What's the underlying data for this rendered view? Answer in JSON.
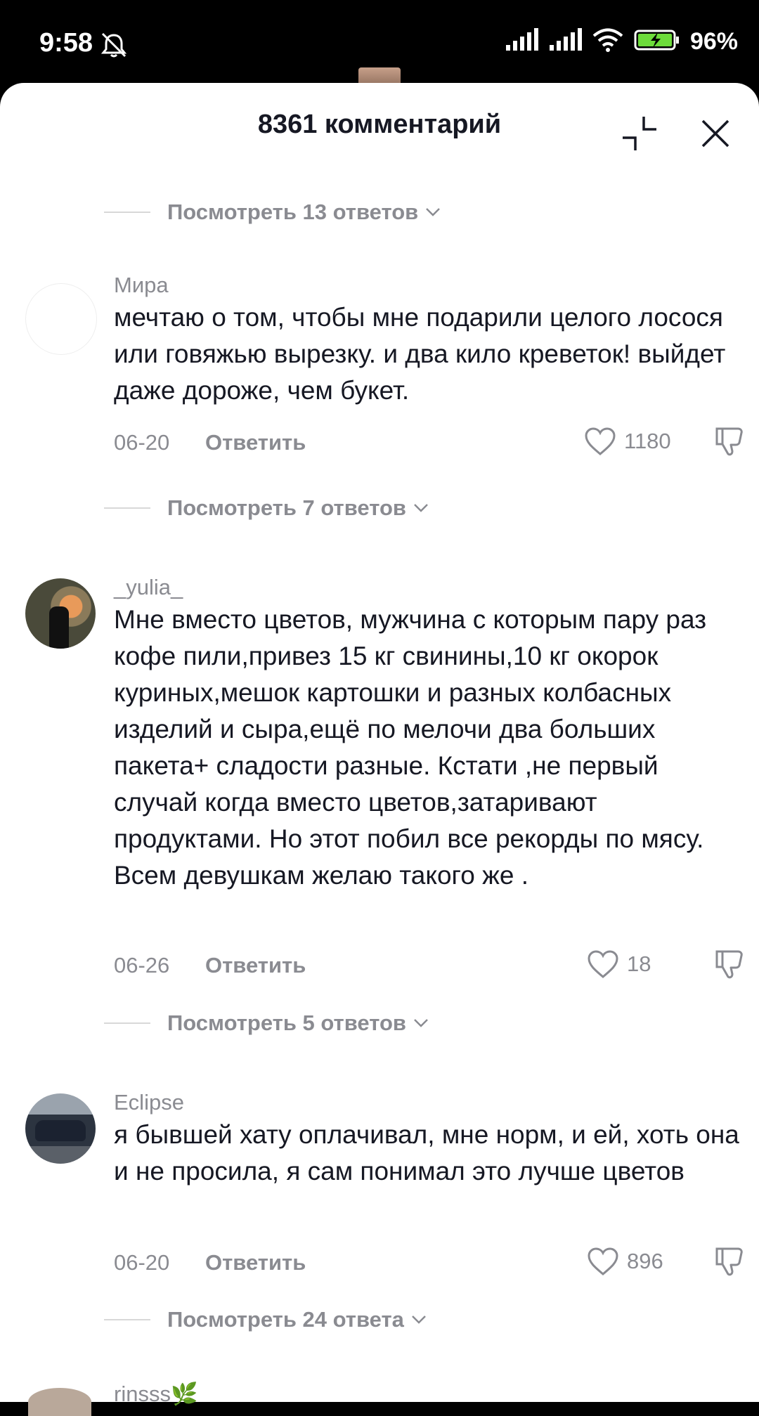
{
  "status_bar": {
    "time": "9:58",
    "battery": "96%",
    "icons": [
      "mute-icon",
      "signal-icon",
      "signal-icon",
      "wifi-icon",
      "battery-charging-icon"
    ]
  },
  "header": {
    "title": "8361 комментарий"
  },
  "top_replies": {
    "label": "Посмотреть 13 ответов"
  },
  "comments": [
    {
      "username": "Мира",
      "text": "мечтаю о том, чтобы мне подарили целого лосося или говяжью вырезку. и два кило креветок! выйдет даже дороже, чем букет.",
      "date": "06-20",
      "reply_label": "Ответить",
      "likes": "1180",
      "view_replies": "Посмотреть 7 ответов"
    },
    {
      "username": "_yulia_",
      "text": "Мне вместо цветов, мужчина с которым пару раз кофе пили,привез 15 кг свинины,10 кг окорок куриных,мешок картошки и разных колбасных изделий и сыра,ещё по мелочи два больших пакета+ сладости разные. Кстати ,не первый случай когда вместо цветов,затаривают продуктами. Но этот побил все рекорды по мясу. Всем девушкам желаю такого же .",
      "date": "06-26",
      "reply_label": "Ответить",
      "likes": "18",
      "view_replies": "Посмотреть 5 ответов"
    },
    {
      "username": "Eclipse",
      "text": "я бывшей хату оплачивал, мне норм, и ей, хоть она и не просила, я сам понимал это лучше цветов",
      "date": "06-20",
      "reply_label": "Ответить",
      "likes": "896",
      "view_replies": "Посмотреть 24 ответа"
    }
  ],
  "partial_comment": {
    "username": "rinsss🌿"
  }
}
